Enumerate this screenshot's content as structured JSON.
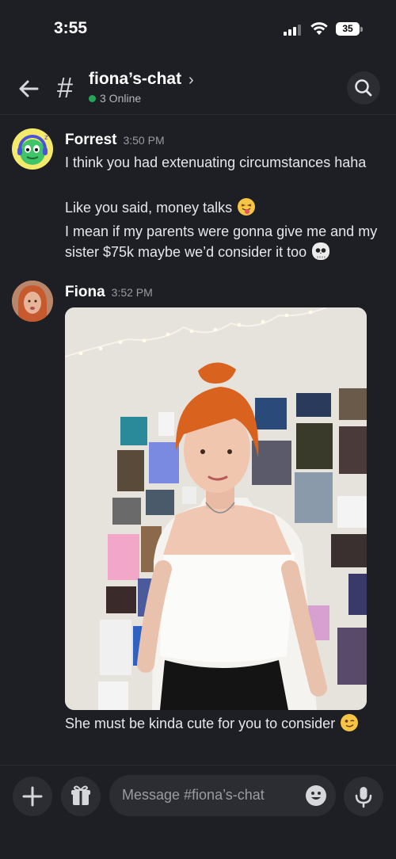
{
  "status_bar": {
    "time": "3:55",
    "battery": "35"
  },
  "header": {
    "hash": "#",
    "channel_name": "fiona’s-chat",
    "chevron": "›",
    "online": "3 Online"
  },
  "messages": [
    {
      "author": "Forrest",
      "time": "3:50 PM",
      "lines": [
        "I think you had extenuating circumstances haha",
        "Like you said, money talks",
        "I mean if my parents were gonna give me and my sister $75k maybe we’d consider it too"
      ]
    },
    {
      "author": "Fiona",
      "time": "3:52 PM",
      "caption": "She must be kinda cute for you to consider"
    }
  ],
  "composer": {
    "placeholder": "Message #fiona’s-chat"
  },
  "colors": {
    "online": "#23a55a",
    "background": "#1e1f25",
    "surface": "#2b2d33"
  }
}
